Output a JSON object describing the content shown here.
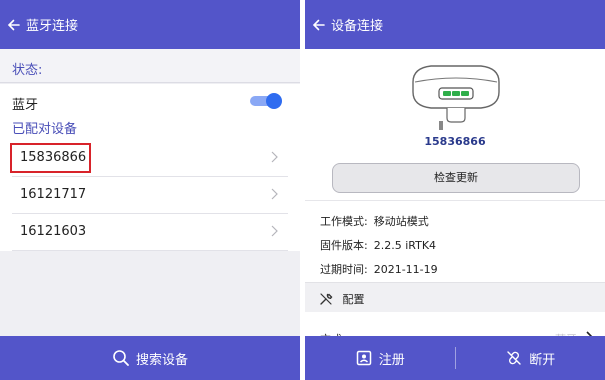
{
  "left": {
    "title": "蓝牙连接",
    "status_label": "状态:",
    "bluetooth_label": "蓝牙",
    "bluetooth_on": true,
    "paired_label": "已配对设备",
    "devices": [
      "15836866",
      "16121717",
      "16121603"
    ],
    "search_label": "搜索设备"
  },
  "right": {
    "title": "设备连接",
    "serial": "15836866",
    "check_update": "检查更新",
    "work_mode_label": "工作模式:",
    "work_mode_value": "移动站模式",
    "firmware_label": "固件版本:",
    "firmware_value": "2.2.5 iRTK4",
    "expire_label": "过期时间:",
    "expire_value": "2021-11-19",
    "config_label": "配置",
    "mode_label": "方式",
    "mode_value": "蓝牙",
    "register_label": "注册",
    "disconnect_label": "断开"
  },
  "colors": {
    "primary": "#5355c9",
    "accent_text": "#4a4fb8",
    "highlight": "#d8232a",
    "toggle": "#2f6cf0"
  },
  "icons": [
    "back-arrow-icon",
    "search-icon",
    "chevron-right-icon",
    "wrench-icon",
    "register-icon",
    "disconnect-icon",
    "receiver-icon"
  ]
}
